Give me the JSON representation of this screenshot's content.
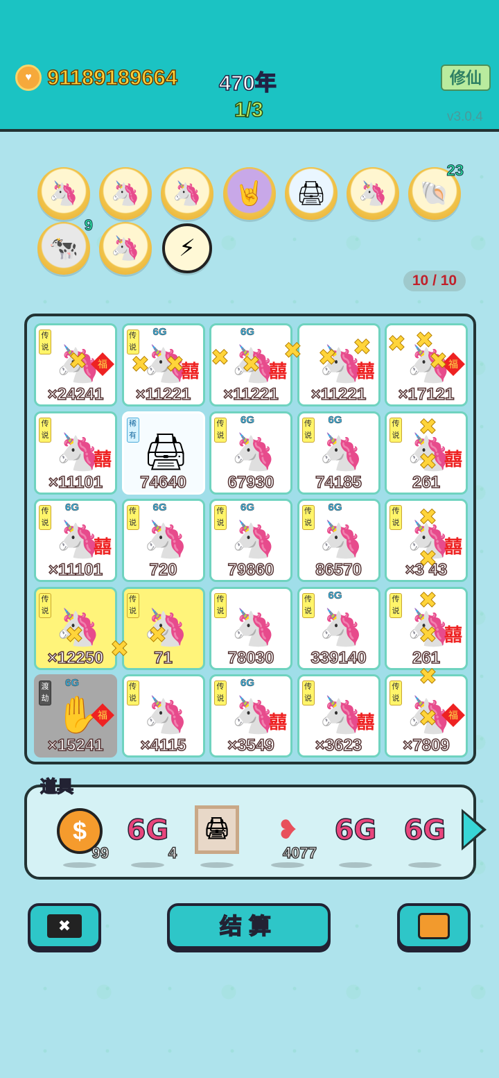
{
  "header": {
    "coins": "91189189664",
    "year": "470年",
    "progress": "1/3",
    "cultivate_label": "修仙",
    "version": "v3.0.4"
  },
  "buffs": [
    {
      "icon": "unicorn-icon",
      "count": ""
    },
    {
      "icon": "unicorn-icon",
      "count": ""
    },
    {
      "icon": "unicorn-icon",
      "count": ""
    },
    {
      "icon": "rock-hand-icon",
      "count": ""
    },
    {
      "icon": "printer-icon",
      "count": ""
    },
    {
      "icon": "unicorn-icon",
      "count": ""
    },
    {
      "icon": "shell-icon",
      "count": "23"
    },
    {
      "icon": "cow-pair-icon",
      "count": "9"
    },
    {
      "icon": "unicorn-icon",
      "count": ""
    },
    {
      "icon": "lightning-icon",
      "count": ""
    }
  ],
  "slot_counter": "10 / 10",
  "board": {
    "cells": [
      {
        "tag": "传说",
        "g6": false,
        "mult": "×24241",
        "style": "normal",
        "extra": "fu"
      },
      {
        "tag": "传说",
        "g6": true,
        "mult": "×11221",
        "style": "normal",
        "extra": "xi"
      },
      {
        "tag": "",
        "g6": true,
        "mult": "×11221",
        "style": "normal",
        "extra": "xi"
      },
      {
        "tag": "",
        "g6": false,
        "mult": "×11221",
        "style": "normal",
        "extra": "xi"
      },
      {
        "tag": "",
        "g6": false,
        "mult": "×17121",
        "style": "normal",
        "extra": "fu"
      },
      {
        "tag": "传说",
        "g6": false,
        "mult": "×11101",
        "style": "normal",
        "extra": "xi"
      },
      {
        "tag": "稀有",
        "g6": false,
        "mult": "74640",
        "style": "plain",
        "extra": ""
      },
      {
        "tag": "传说",
        "g6": true,
        "mult": "67930",
        "style": "normal",
        "extra": ""
      },
      {
        "tag": "传说",
        "g6": true,
        "mult": "74185",
        "style": "normal",
        "extra": ""
      },
      {
        "tag": "传说",
        "g6": false,
        "mult": "261",
        "style": "normal",
        "extra": "xi"
      },
      {
        "tag": "传说",
        "g6": true,
        "mult": "×11101",
        "style": "normal",
        "extra": "xi"
      },
      {
        "tag": "传说",
        "g6": true,
        "mult": "720",
        "style": "normal",
        "extra": ""
      },
      {
        "tag": "传说",
        "g6": true,
        "mult": "79860",
        "style": "normal",
        "extra": ""
      },
      {
        "tag": "传说",
        "g6": true,
        "mult": "86570",
        "style": "normal",
        "extra": ""
      },
      {
        "tag": "传说",
        "g6": false,
        "mult": "×3 43",
        "style": "normal",
        "extra": "xi"
      },
      {
        "tag": "传说",
        "g6": false,
        "mult": "×12250",
        "style": "gold",
        "extra": ""
      },
      {
        "tag": "传说",
        "g6": false,
        "mult": "71",
        "style": "gold",
        "extra": ""
      },
      {
        "tag": "传说",
        "g6": false,
        "mult": "78030",
        "style": "normal",
        "extra": ""
      },
      {
        "tag": "传说",
        "g6": true,
        "mult": "339140",
        "style": "normal",
        "extra": ""
      },
      {
        "tag": "传说",
        "g6": false,
        "mult": "261",
        "style": "normal",
        "extra": "xi"
      },
      {
        "tag": "渡劫",
        "g6": true,
        "mult": "×15241",
        "style": "gray",
        "extra": "fu"
      },
      {
        "tag": "传说",
        "g6": false,
        "mult": "×4115",
        "style": "normal",
        "extra": ""
      },
      {
        "tag": "传说",
        "g6": true,
        "mult": "×3549",
        "style": "normal",
        "extra": "xi"
      },
      {
        "tag": "传说",
        "g6": false,
        "mult": "×3623",
        "style": "normal",
        "extra": "xi"
      },
      {
        "tag": "传说",
        "g6": false,
        "mult": "×7809",
        "style": "normal",
        "extra": "fu"
      }
    ],
    "g6_label": "6G",
    "xi_label": "囍",
    "fu_label": "福"
  },
  "items": {
    "title": "道具",
    "list": [
      {
        "icon": "dollar-coin-icon",
        "qty": "99"
      },
      {
        "icon": "6g-icon",
        "qty": "4"
      },
      {
        "icon": "printer-frame-icon",
        "qty": ""
      },
      {
        "icon": "liver-icon",
        "qty": "4077"
      },
      {
        "icon": "6g-icon",
        "qty": ""
      },
      {
        "icon": "6g-icon",
        "qty": ""
      }
    ],
    "g6_label": "6G",
    "coin_symbol": "$"
  },
  "buttons": {
    "close_symbol": "✖",
    "settle_label": "结算"
  },
  "colors": {
    "header": "#1bc3c3",
    "background": "#aee3ec",
    "cell_border": "#6fd3bf",
    "accent_gold": "#ffd23a"
  }
}
